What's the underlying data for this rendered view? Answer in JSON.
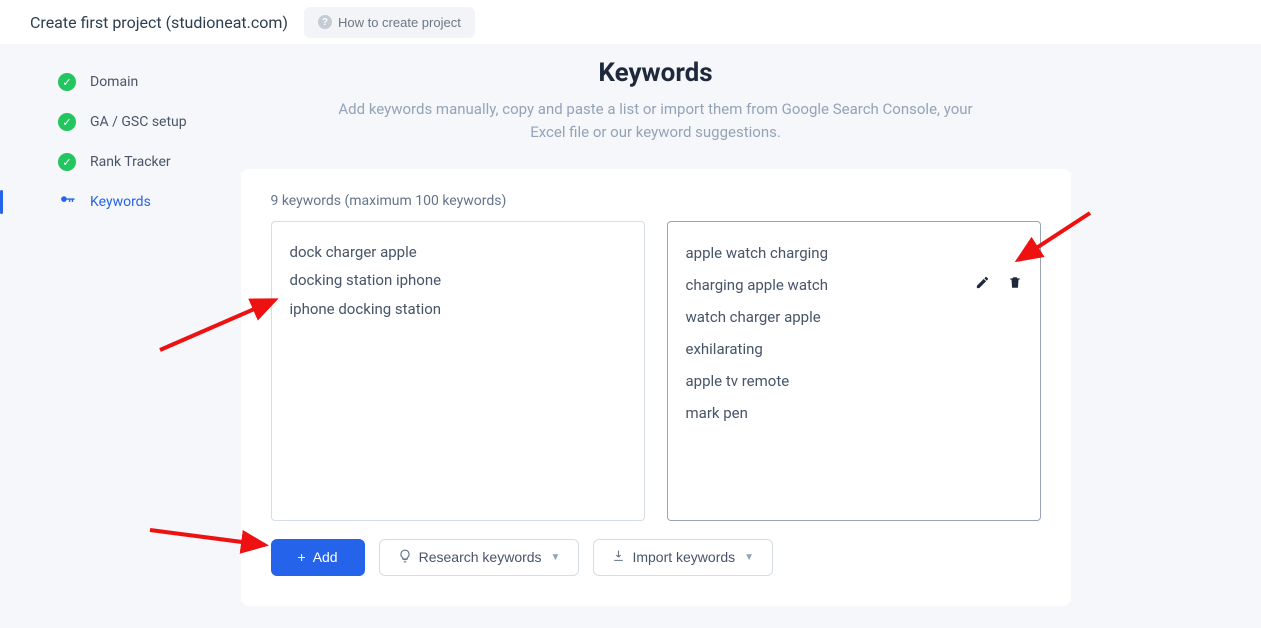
{
  "header": {
    "title": "Create first project (studioneat.com)",
    "help_label": "How to create project"
  },
  "sidebar": {
    "items": [
      {
        "label": "Domain",
        "done": true
      },
      {
        "label": "GA / GSC setup",
        "done": true
      },
      {
        "label": "Rank Tracker",
        "done": true
      },
      {
        "label": "Keywords",
        "done": false,
        "active": true
      }
    ]
  },
  "main": {
    "heading": "Keywords",
    "subheading": "Add keywords manually, copy and paste a list or import them from Google Search Console, your Excel file or our keyword suggestions.",
    "count_label": "9 keywords (maximum 100 keywords)",
    "left_keywords": [
      "dock charger apple",
      "docking station iphone",
      "iphone docking station"
    ],
    "right_keywords": [
      "apple watch charging",
      "charging apple watch",
      "watch charger apple",
      "exhilarating",
      "apple tv remote",
      "mark pen"
    ],
    "hover_index": 1,
    "buttons": {
      "add": "Add",
      "research": "Research keywords",
      "import": "Import keywords"
    }
  }
}
